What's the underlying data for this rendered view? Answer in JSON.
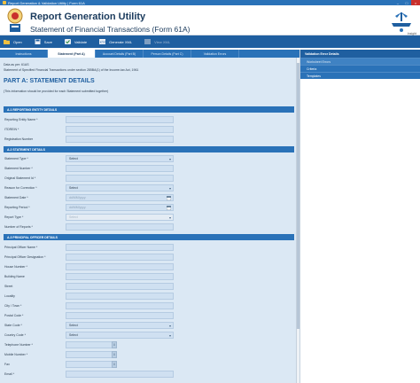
{
  "window": {
    "title": "Report Generation & Validation Utility | Form 61A"
  },
  "header": {
    "title": "Report Generation Utility",
    "subtitle": "Statement of Financial Transactions (Form 61A)",
    "brand": "Insight"
  },
  "toolbar": {
    "open": "Open",
    "save": "Save",
    "validate": "Validate",
    "generate_xml": "Generate XML",
    "view_xml": "View XML"
  },
  "tabs": [
    {
      "label": "Instructions"
    },
    {
      "label": "Statement (Part A)"
    },
    {
      "label": "Account Details (Part B)"
    },
    {
      "label": "Person Details (Part C)"
    },
    {
      "label": "Validation Errors"
    }
  ],
  "doc": {
    "info_line1": "Data as per: 61AS",
    "info_line2": "Statement of Specified Financial Transactions under section 285BA(1) of the Income-tax Act, 1961",
    "part_title": "PART A: STATEMENT DETAILS",
    "part_note": "(This information should be provided for each Statement submitted together)"
  },
  "sections": {
    "reporting_entity": "A.1 REPORTING ENTITY DETAILS",
    "statement_details": "A.2 STATEMENT DETAILS",
    "principal_officer": "A.3 PRINCIPAL OFFICER DETAILS"
  },
  "fields": {
    "reporting_entity_name": "Reporting Entity Name *",
    "itdrein": "ITDREIN *",
    "registration_number": "Registration Number",
    "statement_type": "Statement Type *",
    "statement_number": "Statement Number *",
    "original_statement_id": "Original Statement Id *",
    "reason_for_correction": "Reason for Correction *",
    "statement_date": "Statement Date *",
    "reporting_period": "Reporting Period *",
    "report_type": "Report Type *",
    "number_of_reports": "Number of Reports *",
    "principal_officer_name": "Principal Officer Name *",
    "principal_officer_designation": "Principal Officer Designation *",
    "house_number": "House Number *",
    "building_name": "Building Name",
    "street": "Street",
    "locality": "Locality",
    "city_town": "City / Town *",
    "postal_code": "Postal Code *",
    "state_code": "State Code *",
    "country_code": "Country Code *",
    "telephone_number": "Telephone Number *",
    "mobile_number": "Mobile Number *",
    "fax": "Fax",
    "email": "Email *"
  },
  "values": {
    "statement_type": "Select",
    "reason_for_correction": "Select",
    "statement_date": "dd/MM/yyyy",
    "reporting_period": "dd/MM/yyyy",
    "report_type": "Select",
    "state_code": "Select",
    "country_code": "Select"
  },
  "right_panel": {
    "heading": "Validation Error Details",
    "items": [
      {
        "label": "Worksheet Errors"
      },
      {
        "label": "Criteria"
      },
      {
        "label": "Templates"
      }
    ]
  },
  "colors": {
    "primary": "#1f5fa0",
    "tab_bar": "#2a72b8",
    "form_bg": "#dbe8f4",
    "field_bg": "#cfe0f1"
  }
}
